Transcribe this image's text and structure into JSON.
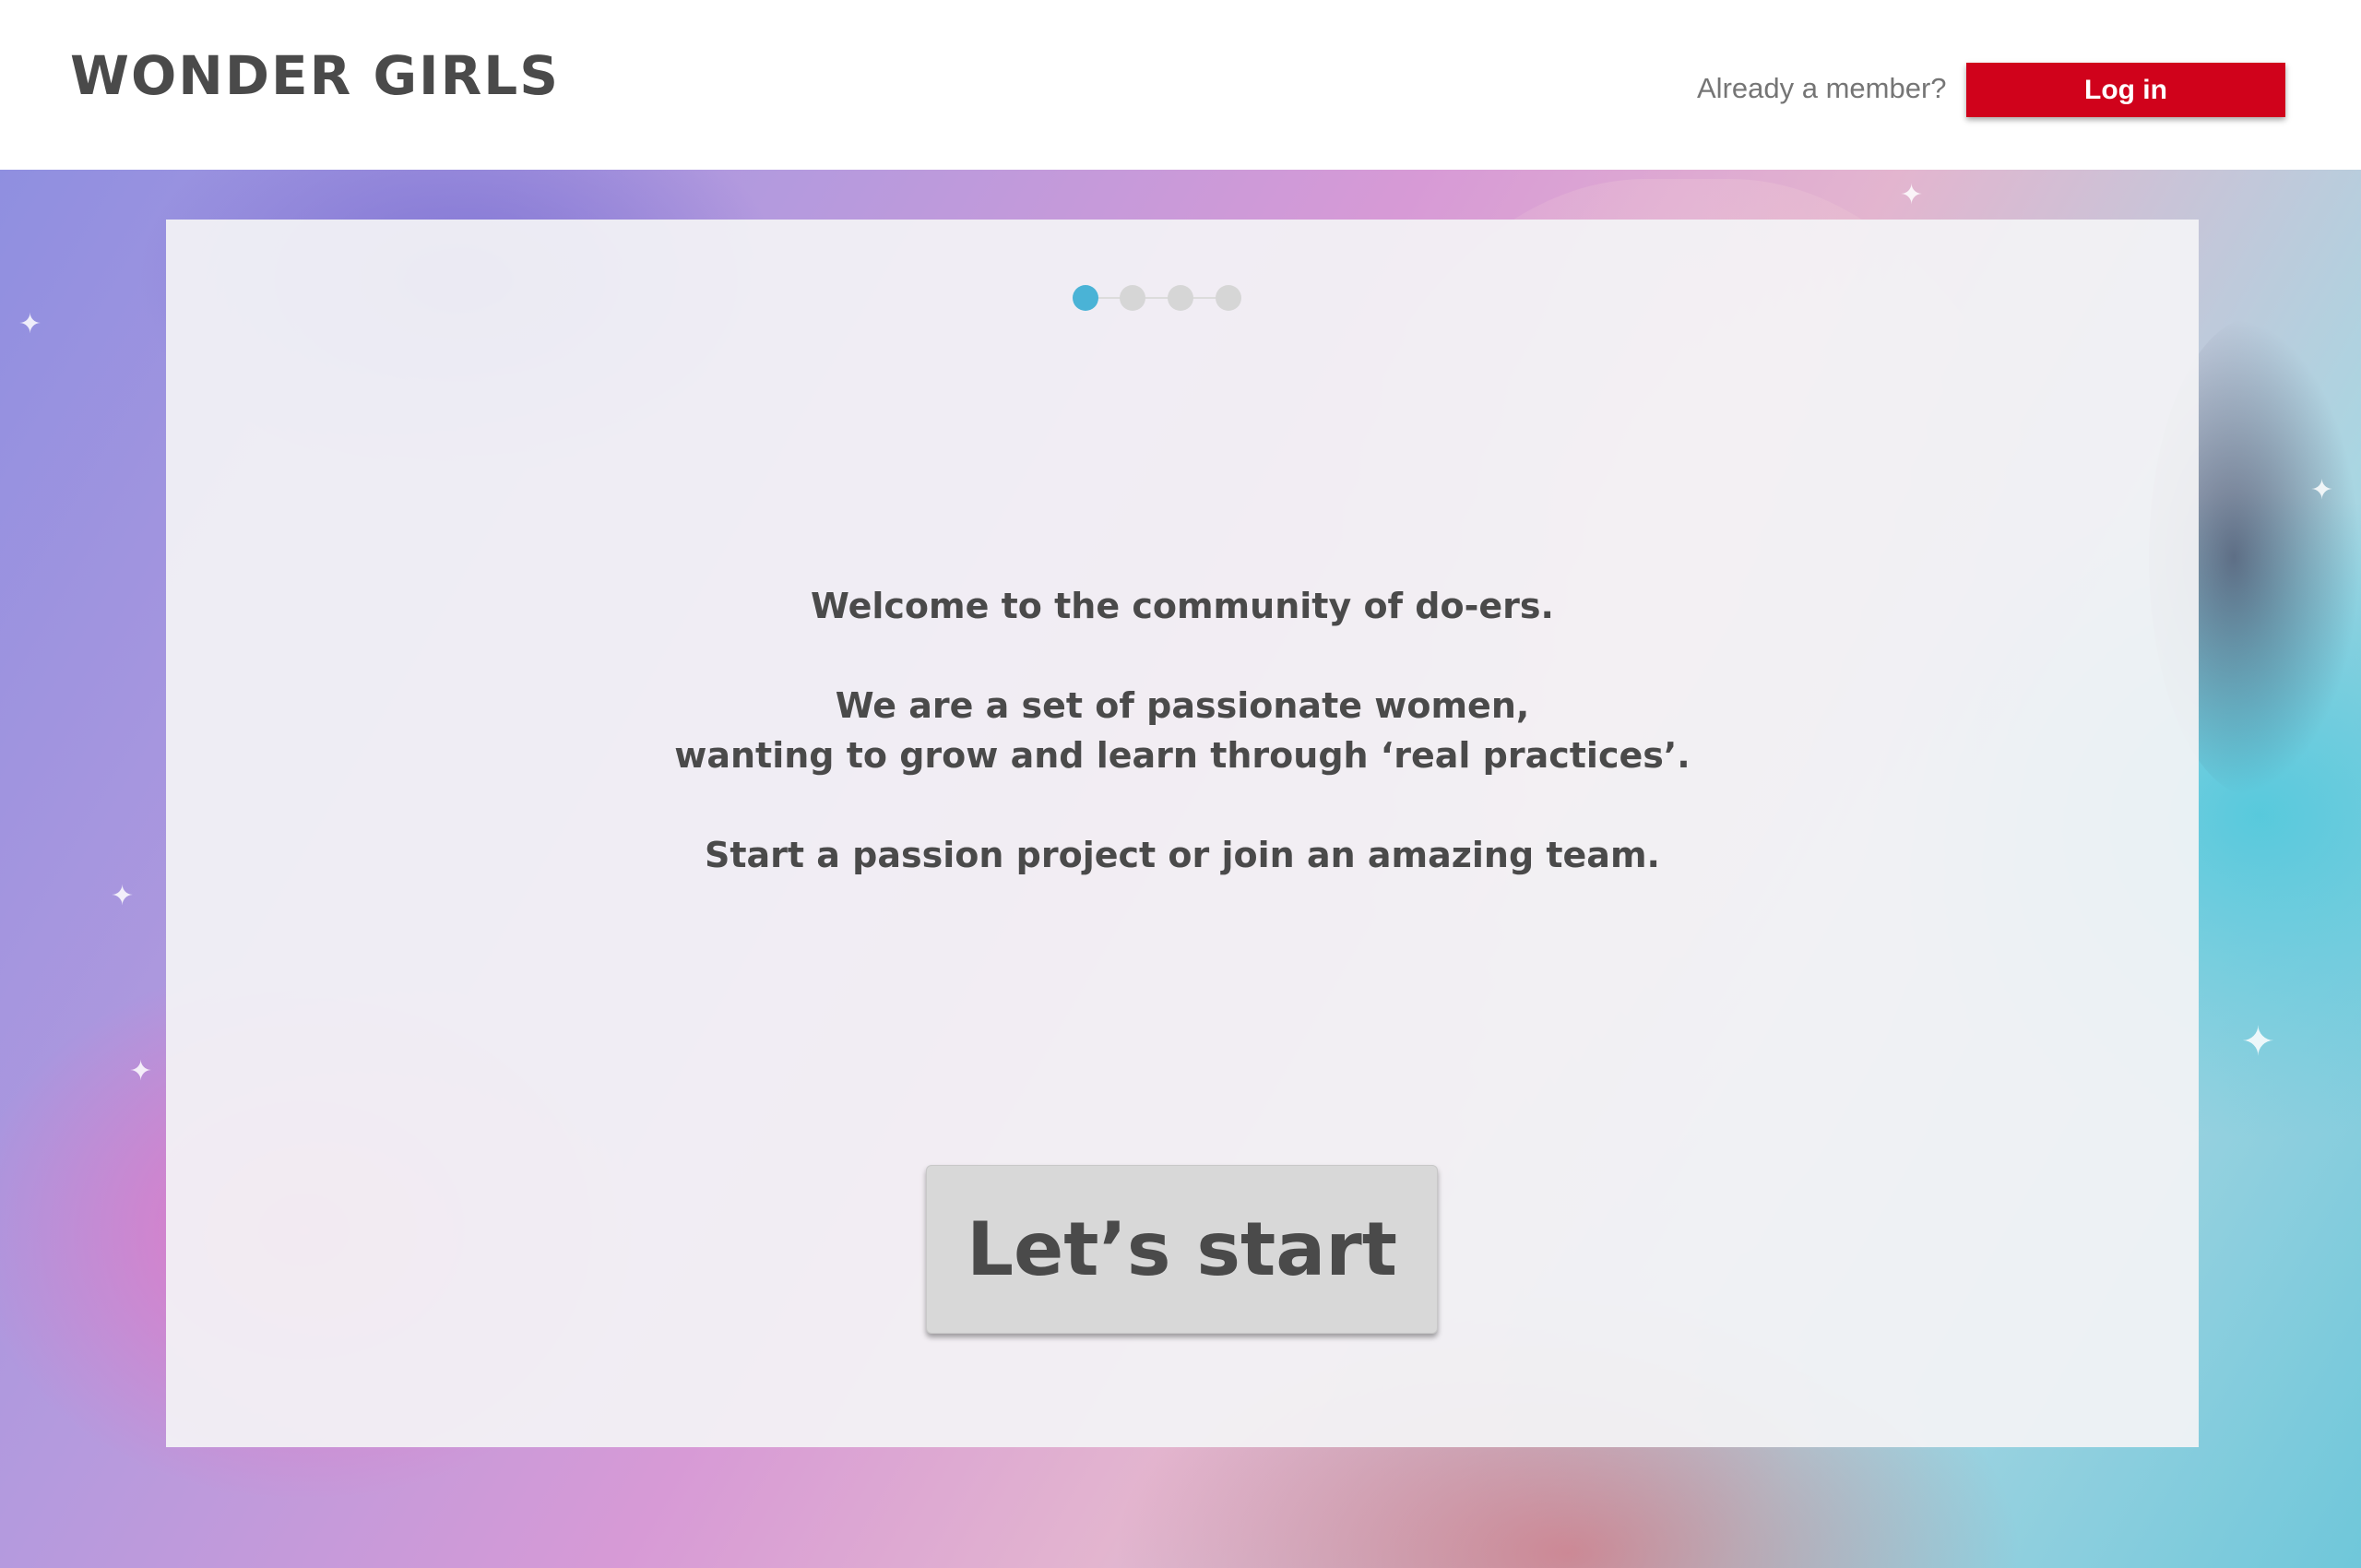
{
  "header": {
    "logo": "WONDER GIRLS",
    "member_prompt": "Already a member?",
    "login_label": "Log in"
  },
  "onboarding": {
    "steps_total": 4,
    "active_step": 1,
    "lines": [
      "Welcome to the community of do-ers.",
      "We are a set of passionate women,",
      "wanting to grow and learn through ‘real practices’.",
      "Start a passion project or join an amazing team."
    ],
    "start_label": "Let’s start"
  },
  "colors": {
    "brand_red": "#d0021b",
    "active_dot": "#4ab3d6",
    "inactive_dot": "#d6d6d6",
    "text_dark": "#4a4a4a"
  }
}
